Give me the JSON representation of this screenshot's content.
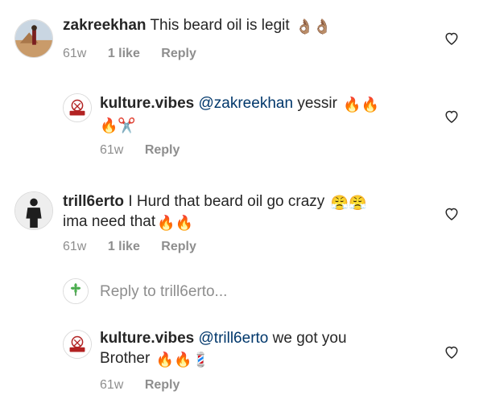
{
  "comments": [
    {
      "username": "zakreekhan",
      "text": "This beard oil is legit",
      "emojis": "👌🏽👌🏽",
      "time": "61w",
      "likes": "1 like",
      "reply": "Reply",
      "avatar_icon": "profile-photo-desert-icon"
    },
    {
      "username": "kulture.vibes",
      "mention": "@zakreekhan",
      "text": "yessir",
      "emojis1": "🔥🔥",
      "emojis2": "🔥✂️",
      "time": "61w",
      "reply": "Reply",
      "avatar_icon": "barbershop-logo-icon"
    },
    {
      "username": "trill6erto",
      "text1": "I Hurd that beard oil go crazy",
      "emojis1": "😤😤",
      "text2": "ima need that",
      "emojis2": "🔥🔥",
      "time": "61w",
      "likes": "1 like",
      "reply": "Reply",
      "avatar_icon": "profile-photo-person-icon"
    },
    {
      "username": "kulture.vibes",
      "mention": "@trill6erto",
      "text1": "we got you",
      "text2": "Brother",
      "emojis2": "🔥🔥💈",
      "time": "61w",
      "reply": "Reply",
      "avatar_icon": "barbershop-logo-icon"
    }
  ],
  "reply_prompt": {
    "text": "Reply to trill6erto...",
    "avatar_icon": "plant-logo-icon"
  },
  "colors": {
    "text": "#262626",
    "muted": "#8e8e8e",
    "mention": "#00376b"
  }
}
